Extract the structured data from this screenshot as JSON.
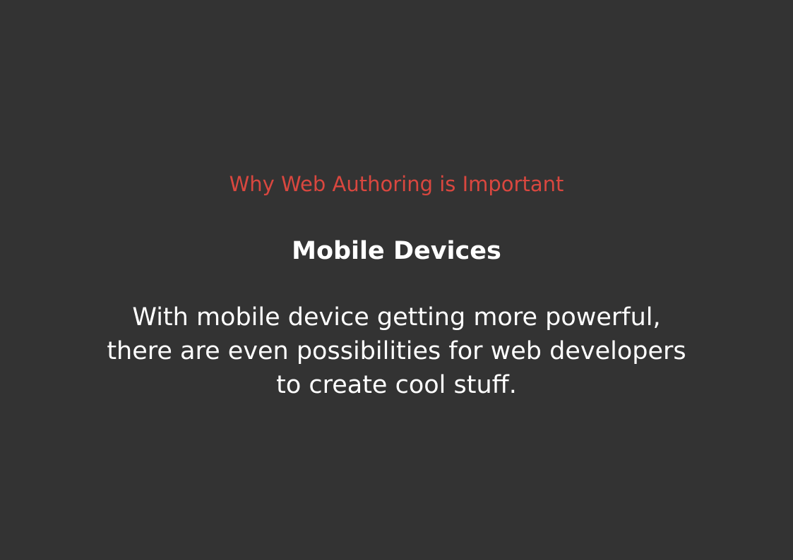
{
  "colors": {
    "background": "#333333",
    "accent": "#d9473f",
    "text": "#ffffff"
  },
  "slide": {
    "kicker": "Why Web Authoring is Important",
    "heading": "Mobile Devices",
    "body_lines": [
      "With mobile device getting more powerful,",
      "there are even possibilities for web developers",
      "to create cool stuff."
    ]
  }
}
